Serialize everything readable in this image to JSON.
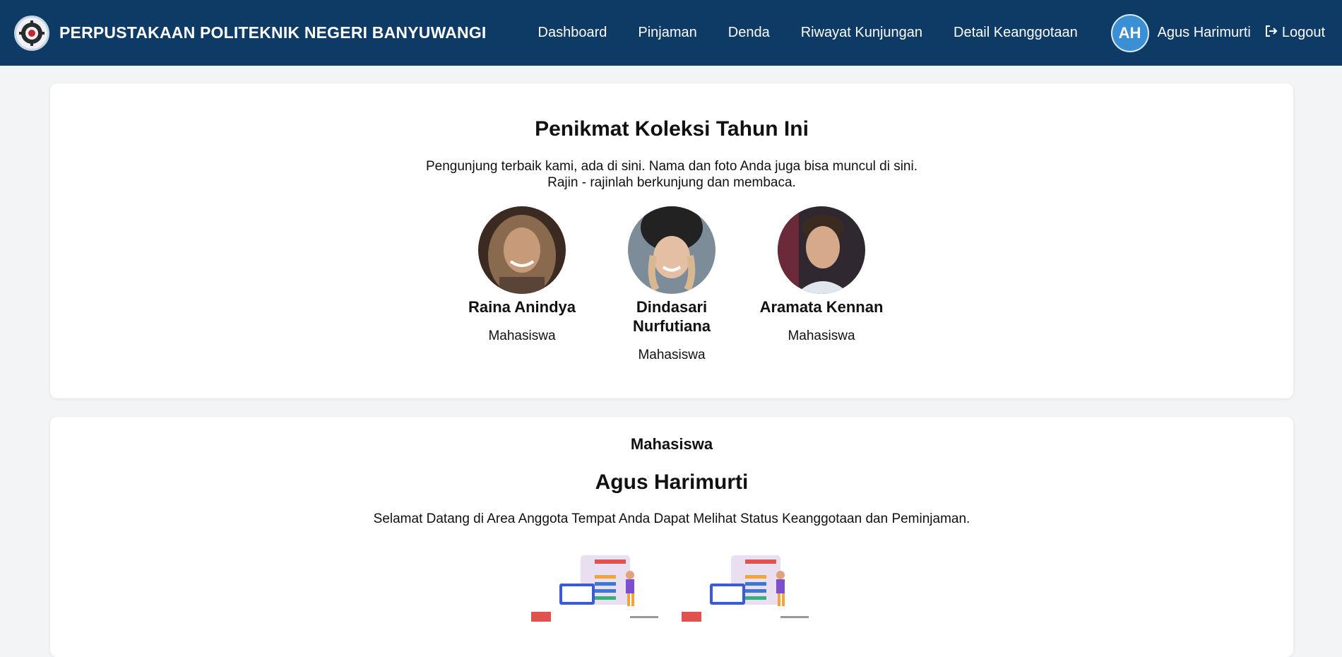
{
  "header": {
    "brand_title": "PERPUSTAKAAN POLITEKNIK NEGERI BANYUWANGI",
    "nav": [
      "Dashboard",
      "Pinjaman",
      "Denda",
      "Riwayat Kunjungan",
      "Detail Keanggotaan"
    ],
    "user_initials": "AH",
    "user_name": "Agus Harimurti",
    "logout_label": "Logout"
  },
  "top_readers": {
    "title": "Penikmat Koleksi Tahun Ini",
    "subtitle_line1": "Pengunjung terbaik kami, ada di sini. Nama dan foto Anda juga bisa muncul di sini.",
    "subtitle_line2": "Rajin - rajinlah berkunjung dan membaca.",
    "people": [
      {
        "name": "Raina Anindya",
        "role": "Mahasiswa"
      },
      {
        "name": "Dindasari Nurfutiana",
        "role": "Mahasiswa"
      },
      {
        "name": "Aramata Kennan",
        "role": "Mahasiswa"
      }
    ]
  },
  "member": {
    "role": "Mahasiswa",
    "name": "Agus Harimurti",
    "welcome": "Selamat Datang di Area Anggota Tempat Anda Dapat Melihat Status Keanggotaan dan Peminjaman."
  },
  "colors": {
    "navbar": "#0e3a66",
    "avatar": "#3b8fd4",
    "background": "#f3f4f6"
  }
}
